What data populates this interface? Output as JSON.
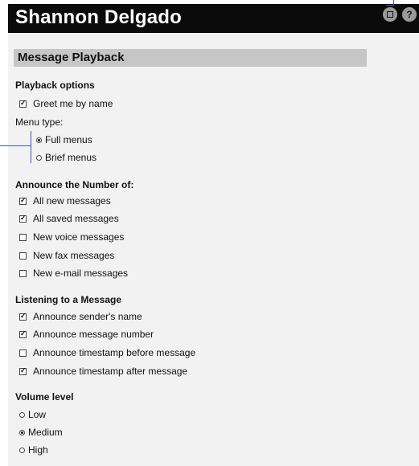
{
  "header": {
    "title": "Shannon Delgado",
    "save_icon": "save-icon",
    "help_icon": "help-icon",
    "help_glyph": "?"
  },
  "section": {
    "title": "Message Playback"
  },
  "playback": {
    "heading": "Playback options",
    "greet": {
      "label": "Greet me by name",
      "checked": true
    },
    "menu_type_label": "Menu type:",
    "full": {
      "label": "Full menus",
      "selected": true
    },
    "brief": {
      "label": "Brief menus",
      "selected": false
    }
  },
  "announce": {
    "heading": "Announce the Number of:",
    "items": [
      {
        "label": "All new messages",
        "checked": true
      },
      {
        "label": "All saved messages",
        "checked": true
      },
      {
        "label": "New voice messages",
        "checked": false
      },
      {
        "label": "New fax messages",
        "checked": false
      },
      {
        "label": "New e-mail messages",
        "checked": false
      }
    ]
  },
  "listening": {
    "heading": "Listening to a Message",
    "items": [
      {
        "label": "Announce sender's name",
        "checked": true
      },
      {
        "label": "Announce message number",
        "checked": true
      },
      {
        "label": "Announce timestamp before message",
        "checked": false
      },
      {
        "label": "Announce timestamp after message",
        "checked": true
      }
    ]
  },
  "volume": {
    "heading": "Volume level",
    "options": [
      {
        "label": "Low",
        "selected": false
      },
      {
        "label": "Medium",
        "selected": true
      },
      {
        "label": "High",
        "selected": false
      }
    ]
  },
  "colors": {
    "titlebar": "#0b0b0b",
    "panel": "#f2f2f2",
    "section_bar": "#c6c6c6",
    "callout": "#2f5cb8"
  }
}
